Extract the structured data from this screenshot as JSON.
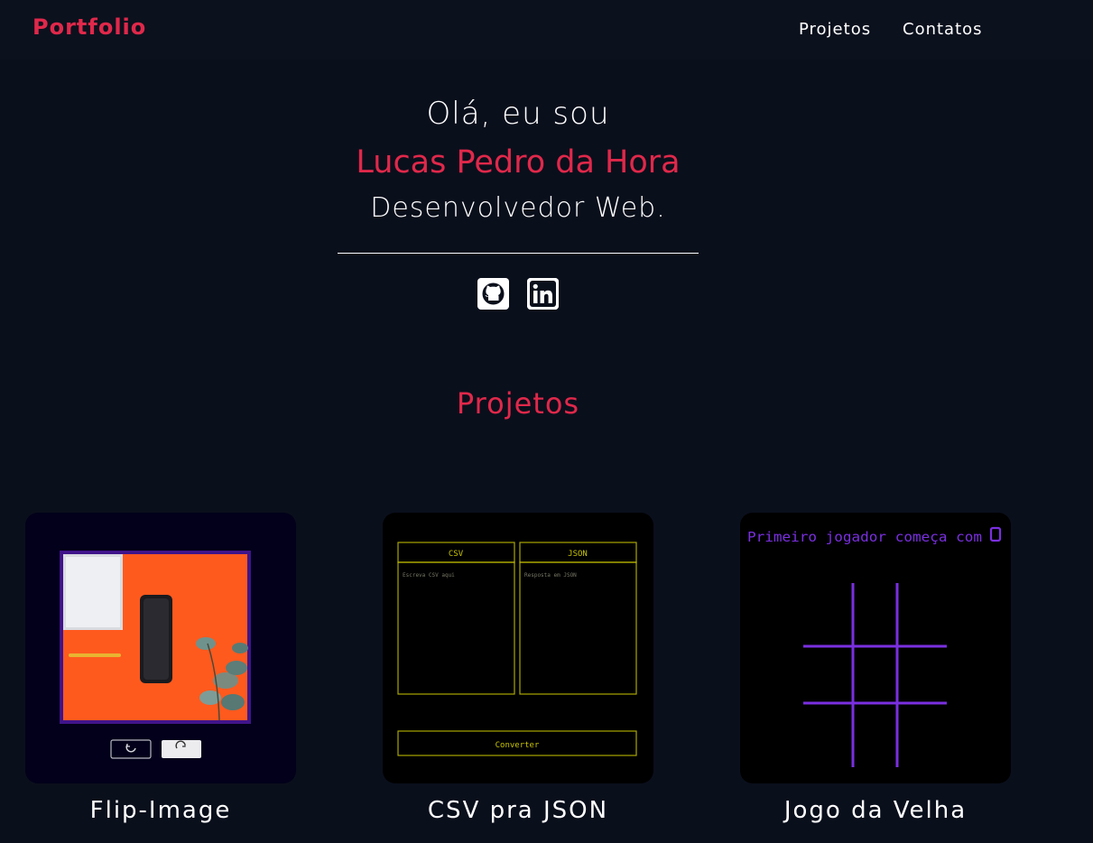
{
  "navbar": {
    "brand": "Portfolio",
    "links": [
      "Projetos",
      "Contatos"
    ]
  },
  "hero": {
    "greeting": "Olá, eu sou",
    "name": "Lucas Pedro da Hora",
    "role": "Desenvolvedor Web."
  },
  "social": {
    "icons": [
      "github-icon",
      "linkedin-icon"
    ]
  },
  "projects": {
    "title": "Projetos",
    "items": [
      {
        "title": "Flip-Image"
      },
      {
        "title": "CSV pra JSON",
        "csv_label": "CSV",
        "json_label": "JSON",
        "csv_placeholder": "Escreva CSV aqui",
        "json_placeholder": "Resposta em JSON",
        "convert_label": "Converter"
      },
      {
        "title": "Jogo da Velha",
        "status": "Primeiro jogador começa com"
      }
    ]
  },
  "colors": {
    "background": "#0a0f1c",
    "navbar": "#0c111e",
    "accent": "#e0284a",
    "csv_accent": "#c8c400",
    "game_accent": "#7a2fe0",
    "flip_orange": "#ff5a1e"
  }
}
